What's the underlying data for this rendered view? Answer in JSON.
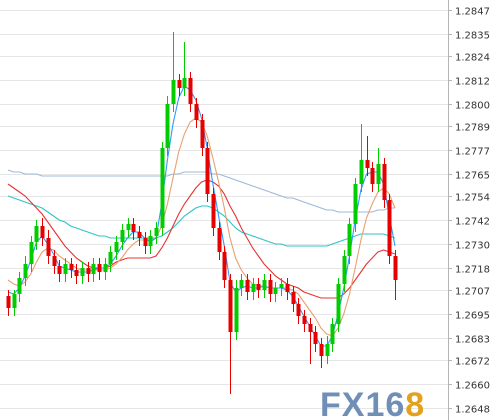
{
  "watermark": {
    "text": "FX168",
    "colors": {
      "fx": "#6f8fb6",
      "num": "#6f8fb6",
      "last_digit": "#e3a11c"
    }
  },
  "colors": {
    "bull": "#00cc00",
    "bear": "#e60000",
    "ma_fast": "#3399ff",
    "ma_mid": "#e8a070",
    "ma_slow": "#e53333",
    "ma_long1": "#2ec4c4",
    "ma_long2": "#9cb8d8",
    "grid": "#e6e6e6",
    "axis": "#b5b5b5"
  },
  "chart_data": {
    "type": "candlestick",
    "title": "",
    "xlabel": "",
    "ylabel": "",
    "ylim": [
      1.2642,
      1.2852
    ],
    "y_ticks": [
      "1.2847",
      "1.2835",
      "1.2824",
      "1.2812",
      "1.2800",
      "1.2789",
      "1.2777",
      "1.2765",
      "1.2754",
      "1.2742",
      "1.2730",
      "1.2718",
      "1.2707",
      "1.2695",
      "1.2683",
      "1.2672",
      "1.2660",
      "1.2648"
    ],
    "y_axis_position": "right",
    "grid": true,
    "grid_axis": "y",
    "legend": "none",
    "candles": [
      [
        1.2704,
        1.2698,
        1.2707,
        1.2694
      ],
      [
        1.2698,
        1.2705,
        1.2707,
        1.2694
      ],
      [
        1.2705,
        1.2713,
        1.2716,
        1.2701
      ],
      [
        1.2713,
        1.272,
        1.2724,
        1.2709
      ],
      [
        1.272,
        1.2731,
        1.2734,
        1.2716
      ],
      [
        1.2731,
        1.2739,
        1.2742,
        1.2727
      ],
      [
        1.2739,
        1.2733,
        1.2743,
        1.2729
      ],
      [
        1.2733,
        1.2724,
        1.2737,
        1.272
      ],
      [
        1.2724,
        1.2719,
        1.2727,
        1.2715
      ],
      [
        1.2719,
        1.2715,
        1.2722,
        1.2711
      ],
      [
        1.2715,
        1.272,
        1.2723,
        1.2711
      ],
      [
        1.272,
        1.2717,
        1.2723,
        1.2713
      ],
      [
        1.2717,
        1.2714,
        1.272,
        1.271
      ],
      [
        1.2714,
        1.2718,
        1.2721,
        1.271
      ],
      [
        1.2718,
        1.2715,
        1.2721,
        1.2711
      ],
      [
        1.2715,
        1.272,
        1.2723,
        1.2711
      ],
      [
        1.272,
        1.2716,
        1.2723,
        1.2712
      ],
      [
        1.2716,
        1.272,
        1.2723,
        1.2712
      ],
      [
        1.272,
        1.2726,
        1.2729,
        1.2716
      ],
      [
        1.2726,
        1.2731,
        1.2734,
        1.2722
      ],
      [
        1.2731,
        1.2737,
        1.274,
        1.2727
      ],
      [
        1.2737,
        1.274,
        1.2743,
        1.2733
      ],
      [
        1.274,
        1.2736,
        1.2743,
        1.2732
      ],
      [
        1.2736,
        1.2733,
        1.2739,
        1.2729
      ],
      [
        1.2733,
        1.2729,
        1.2736,
        1.2725
      ],
      [
        1.2729,
        1.2734,
        1.2737,
        1.2725
      ],
      [
        1.2734,
        1.2738,
        1.2741,
        1.273
      ],
      [
        1.2738,
        1.2778,
        1.2781,
        1.2734
      ],
      [
        1.2778,
        1.28,
        1.2804,
        1.2774
      ],
      [
        1.28,
        1.2812,
        1.2836,
        1.2796
      ],
      [
        1.2812,
        1.2808,
        1.2815,
        1.2804
      ],
      [
        1.2808,
        1.2813,
        1.2831,
        1.2804
      ],
      [
        1.2813,
        1.28,
        1.2816,
        1.2796
      ],
      [
        1.28,
        1.2792,
        1.2803,
        1.2788
      ],
      [
        1.2792,
        1.2778,
        1.2795,
        1.2774
      ],
      [
        1.2778,
        1.2755,
        1.2781,
        1.2751
      ],
      [
        1.2755,
        1.2738,
        1.2758,
        1.2734
      ],
      [
        1.2738,
        1.2726,
        1.2741,
        1.2722
      ],
      [
        1.2726,
        1.2712,
        1.2729,
        1.2708
      ],
      [
        1.2712,
        1.2686,
        1.2715,
        1.2655
      ],
      [
        1.2686,
        1.2708,
        1.2712,
        1.2682
      ],
      [
        1.2708,
        1.2712,
        1.2715,
        1.2704
      ],
      [
        1.2712,
        1.2706,
        1.2715,
        1.2702
      ],
      [
        1.2706,
        1.271,
        1.2713,
        1.2702
      ],
      [
        1.271,
        1.2707,
        1.2713,
        1.2703
      ],
      [
        1.2707,
        1.2712,
        1.2715,
        1.2703
      ],
      [
        1.2712,
        1.2705,
        1.2715,
        1.2701
      ],
      [
        1.2705,
        1.2708,
        1.2711,
        1.2701
      ],
      [
        1.2708,
        1.271,
        1.2713,
        1.2704
      ],
      [
        1.271,
        1.2706,
        1.2713,
        1.2702
      ],
      [
        1.2706,
        1.27,
        1.2709,
        1.2696
      ],
      [
        1.27,
        1.2694,
        1.2703,
        1.269
      ],
      [
        1.2694,
        1.269,
        1.2697,
        1.2686
      ],
      [
        1.269,
        1.2686,
        1.2693,
        1.267
      ],
      [
        1.2686,
        1.268,
        1.2689,
        1.2676
      ],
      [
        1.268,
        1.2674,
        1.2683,
        1.2668
      ],
      [
        1.2674,
        1.268,
        1.2684,
        1.267
      ],
      [
        1.268,
        1.269,
        1.2693,
        1.2676
      ],
      [
        1.269,
        1.271,
        1.2713,
        1.2686
      ],
      [
        1.271,
        1.2724,
        1.2727,
        1.2706
      ],
      [
        1.2724,
        1.274,
        1.2743,
        1.272
      ],
      [
        1.274,
        1.276,
        1.2763,
        1.2736
      ],
      [
        1.276,
        1.2772,
        1.279,
        1.2756
      ],
      [
        1.2772,
        1.2768,
        1.2784,
        1.2764
      ],
      [
        1.2768,
        1.276,
        1.2771,
        1.2756
      ],
      [
        1.276,
        1.277,
        1.2778,
        1.2756
      ],
      [
        1.277,
        1.2752,
        1.2773,
        1.2748
      ],
      [
        1.2752,
        1.2724,
        1.2755,
        1.272
      ],
      [
        1.2724,
        1.2712,
        1.2727,
        1.2702
      ]
    ],
    "series": [
      {
        "values": [
          1.2706,
          1.2705,
          1.2708,
          1.2714,
          1.2722,
          1.2731,
          1.2734,
          1.273,
          1.2725,
          1.2719,
          1.2718,
          1.2717,
          1.2716,
          1.2716,
          1.2716,
          1.2717,
          1.2718,
          1.2718,
          1.272,
          1.2724,
          1.2729,
          1.2733,
          1.2736,
          1.2736,
          1.2733,
          1.2731,
          1.2733,
          1.275,
          1.2772,
          1.279,
          1.2803,
          1.2809,
          1.2807,
          1.2802,
          1.2793,
          1.2778,
          1.276,
          1.2744,
          1.2729,
          1.2711,
          1.2706,
          1.2708,
          1.2709,
          1.2708,
          1.2708,
          1.2709,
          1.2708,
          1.2708,
          1.2708,
          1.2707,
          1.2704,
          1.2699,
          1.2694,
          1.2689,
          1.2684,
          1.2679,
          1.2679,
          1.2684,
          1.2695,
          1.2708,
          1.2724,
          1.2742,
          1.2757,
          1.2765,
          1.2766,
          1.2766,
          1.276,
          1.2744,
          1.2729
        ]
      },
      {
        "values": [
          1.2712,
          1.271,
          1.2709,
          1.2711,
          1.2715,
          1.2721,
          1.2726,
          1.2728,
          1.2727,
          1.2724,
          1.2722,
          1.272,
          1.2718,
          1.2717,
          1.2717,
          1.2717,
          1.2717,
          1.2717,
          1.2718,
          1.272,
          1.2723,
          1.2727,
          1.273,
          1.2732,
          1.2732,
          1.2732,
          1.2733,
          1.2739,
          1.275,
          1.2763,
          1.2776,
          1.2785,
          1.2791,
          1.2793,
          1.2791,
          1.2784,
          1.2773,
          1.2761,
          1.2748,
          1.2733,
          1.2723,
          1.2717,
          1.2713,
          1.271,
          1.2709,
          1.2709,
          1.2708,
          1.2708,
          1.2708,
          1.2708,
          1.2707,
          1.2705,
          1.2701,
          1.2697,
          1.2693,
          1.2688,
          1.2685,
          1.2684,
          1.2688,
          1.2695,
          1.2705,
          1.2718,
          1.2732,
          1.2743,
          1.275,
          1.2756,
          1.2758,
          1.2755,
          1.2748
        ]
      },
      {
        "values": [
          1.276,
          1.2758,
          1.2756,
          1.2754,
          1.2751,
          1.2748,
          1.2745,
          1.2741,
          1.2737,
          1.2733,
          1.2729,
          1.2726,
          1.2723,
          1.2721,
          1.2719,
          1.2718,
          1.2718,
          1.2718,
          1.2719,
          1.2721,
          1.2722,
          1.2723,
          1.2723,
          1.2723,
          1.2723,
          1.2723,
          1.2724,
          1.2728,
          1.2733,
          1.2739,
          1.2745,
          1.275,
          1.2754,
          1.2758,
          1.2761,
          1.2762,
          1.2761,
          1.2759,
          1.2755,
          1.2749,
          1.2744,
          1.2738,
          1.2733,
          1.2728,
          1.2724,
          1.272,
          1.2717,
          1.2714,
          1.2712,
          1.271,
          1.2709,
          1.2708,
          1.2706,
          1.2705,
          1.2704,
          1.2703,
          1.2703,
          1.2703,
          1.2703,
          1.2705,
          1.2708,
          1.2712,
          1.2716,
          1.272,
          1.2723,
          1.2726,
          1.2727,
          1.2726,
          1.2725
        ]
      },
      {
        "values": [
          1.2754,
          1.2753,
          1.2752,
          1.2751,
          1.275,
          1.2749,
          1.2748,
          1.2746,
          1.2744,
          1.2742,
          1.2741,
          1.2739,
          1.2738,
          1.2737,
          1.2736,
          1.2735,
          1.2734,
          1.2734,
          1.2733,
          1.2733,
          1.2733,
          1.2733,
          1.2733,
          1.2733,
          1.2733,
          1.2733,
          1.2733,
          1.2734,
          1.2736,
          1.2738,
          1.2741,
          1.2744,
          1.2746,
          1.2748,
          1.2749,
          1.2749,
          1.2748,
          1.2746,
          1.2744,
          1.2741,
          1.2738,
          1.2736,
          1.2735,
          1.2734,
          1.2733,
          1.2732,
          1.2731,
          1.273,
          1.273,
          1.2729,
          1.2729,
          1.2729,
          1.2729,
          1.2729,
          1.2729,
          1.2729,
          1.2729,
          1.273,
          1.2731,
          1.2732,
          1.2733,
          1.2734,
          1.2735,
          1.2735,
          1.2735,
          1.2735,
          1.2735,
          1.2734,
          1.2733
        ]
      },
      {
        "values": [
          1.2767,
          1.2766,
          1.2766,
          1.2765,
          1.2765,
          1.2765,
          1.2764,
          1.2764,
          1.2764,
          1.2764,
          1.2764,
          1.2764,
          1.2764,
          1.2764,
          1.2764,
          1.2764,
          1.2764,
          1.2764,
          1.2764,
          1.2764,
          1.2764,
          1.2764,
          1.2764,
          1.2764,
          1.2764,
          1.2764,
          1.2764,
          1.2764,
          1.2764,
          1.2765,
          1.2765,
          1.2766,
          1.2766,
          1.2766,
          1.2766,
          1.2766,
          1.2765,
          1.2765,
          1.2764,
          1.2763,
          1.2762,
          1.2761,
          1.276,
          1.2759,
          1.2758,
          1.2757,
          1.2756,
          1.2755,
          1.2754,
          1.2753,
          1.2753,
          1.2752,
          1.2751,
          1.275,
          1.2749,
          1.2748,
          1.2747,
          1.2747,
          1.2746,
          1.2746,
          1.2746,
          1.2746,
          1.2746,
          1.2746,
          1.2746,
          1.2747,
          1.2747,
          1.2748,
          1.2748
        ]
      }
    ]
  }
}
